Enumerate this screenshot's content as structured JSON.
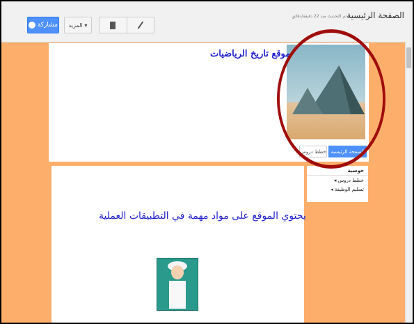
{
  "toolbar": {
    "share_label": "مشاركة",
    "more_label": "المزيد ▾",
    "page_title": "الصفحة الرئيسية",
    "edit_note": "تم التحديث منذ 22 دقيقة/دقائق"
  },
  "site": {
    "title": "موقع تاريخ الرياضيات",
    "nav": {
      "home_label": "الصفحة الرئيسية",
      "lessons_label": "خطط دروس"
    },
    "sidebar": {
      "title": "حوسبة",
      "items": [
        "◂ خطط دروس",
        "◂ تسليم الوظيفة"
      ]
    },
    "content_text": "يحتوي الموقع على مواد مهمة في التطبيقات العملية"
  },
  "colors": {
    "accent": "#4d90fe",
    "site_background": "#fdae6b",
    "annotation": "#a00d0d",
    "title_color": "#1f1fcc"
  }
}
